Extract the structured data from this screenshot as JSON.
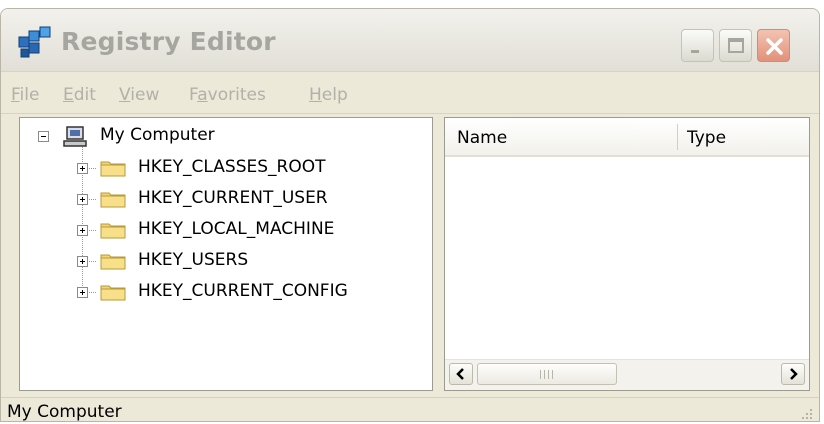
{
  "window": {
    "title": "Registry Editor",
    "icon": "registry-editor-icon",
    "controls": [
      "minimize-icon",
      "maximize-icon",
      "close-icon"
    ]
  },
  "menu": [
    {
      "label": "File",
      "accel": "F",
      "rest": "ile"
    },
    {
      "label": "Edit",
      "accel": "E",
      "rest": "dit"
    },
    {
      "label": "View",
      "accel": "V",
      "rest": "iew"
    },
    {
      "label": "Favorites",
      "pre": "F",
      "accel": "a",
      "rest": "vorites"
    },
    {
      "label": "Help",
      "accel": "H",
      "rest": "elp"
    }
  ],
  "tree": {
    "root": {
      "label": "My Computer",
      "icon": "computer-icon",
      "expanded": true
    },
    "children": [
      {
        "label": "HKEY_CLASSES_ROOT",
        "icon": "folder-icon"
      },
      {
        "label": "HKEY_CURRENT_USER",
        "icon": "folder-icon"
      },
      {
        "label": "HKEY_LOCAL_MACHINE",
        "icon": "folder-icon"
      },
      {
        "label": "HKEY_USERS",
        "icon": "folder-icon"
      },
      {
        "label": "HKEY_CURRENT_CONFIG",
        "icon": "folder-icon"
      }
    ]
  },
  "list": {
    "columns": [
      "Name",
      "Type"
    ]
  },
  "status": {
    "text": "My Computer"
  },
  "colors": {
    "window_bg": "#ECE9D8",
    "close_button": "#E2917A",
    "folder": "#F4D470"
  }
}
